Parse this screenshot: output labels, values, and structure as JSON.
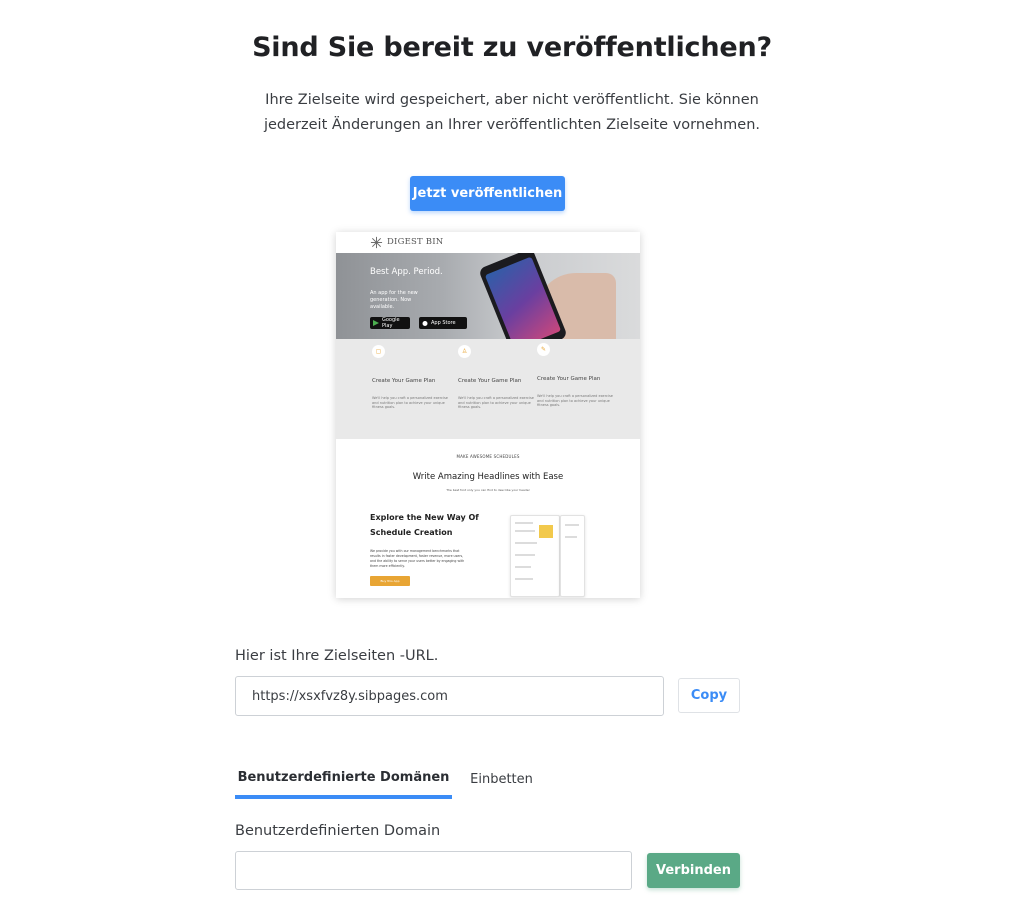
{
  "header": {
    "title": "Sind Sie bereit zu veröffentlichen?",
    "subtitle": "Ihre Zielseite wird gespeichert, aber nicht veröffentlicht. Sie können jederzeit Änderungen an Ihrer veröffentlichten Zielseite vornehmen.",
    "publish_label": "Jetzt veröffentlichen"
  },
  "preview": {
    "brand": "DIGEST BIN",
    "hero_title": "Best App. Period.",
    "hero_sub": "An app for the new generation. Now available.",
    "store_google": "Google Play",
    "store_apple": "App Store",
    "features": [
      {
        "title": "Create Your Game Plan",
        "text": "We'll help you craft a personalized exercise and nutrition plan to achieve your unique fitness goals."
      },
      {
        "title": "Create Your Game Plan",
        "text": "We'll help you craft a personalized exercise and nutrition plan to achieve your unique fitness goals."
      },
      {
        "title": "Create Your Game Plan",
        "text": "We'll help you craft a personalized exercise and nutrition plan to achieve your unique fitness goals."
      }
    ],
    "eyebrow": "MAKE AWESOME SCHEDULES",
    "headline": "Write Amazing Headlines with Ease",
    "tagline": "The best font only you can find to describe your header",
    "explore_title": "Explore the New Way Of Schedule Creation",
    "explore_text": "We provide you with our management benchmarks that results in faster development, faster revenue, more users, and the ability to serve your users better by engaging with them more efficiently.",
    "cta": "Buy this App"
  },
  "url_section": {
    "label": "Hier ist Ihre Zielseiten -URL.",
    "url": "https://xsxfvz8y.sibpages.com",
    "copy_label": "Copy"
  },
  "tabs": {
    "custom": "Benutzerdefinierte Domänen",
    "embed": "Einbetten",
    "active": "custom"
  },
  "domain": {
    "label": "Benutzerdefinierten Domain",
    "value": "",
    "connect_label": "Verbinden"
  },
  "colors": {
    "primary": "#3b8cf6",
    "success": "#5aa986",
    "cta_orange": "#e8a534"
  }
}
